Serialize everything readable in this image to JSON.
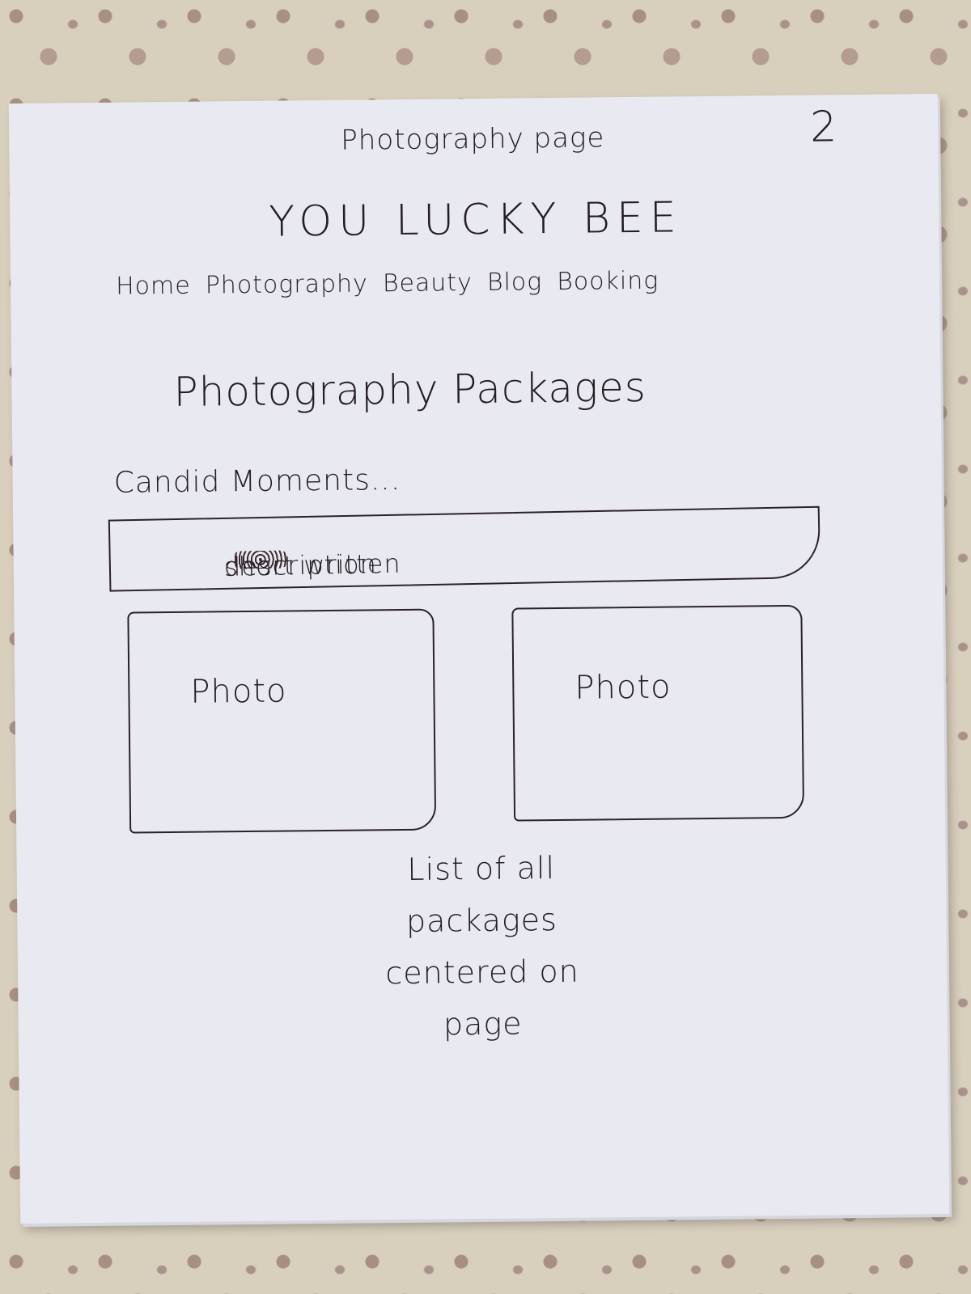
{
  "sketch": {
    "page_label": "Photography page",
    "page_number": "2",
    "brand": "YOU LUCKY BEE",
    "nav": [
      "Home",
      "Photography",
      "Beauty",
      "Blog",
      "Booking"
    ],
    "heading": "Photography Packages",
    "subheading": "Candid Moments...",
    "description_left": "short written",
    "description_right": "description",
    "photos": [
      "Photo",
      "Photo"
    ],
    "note": "List of all packages centered on page"
  }
}
